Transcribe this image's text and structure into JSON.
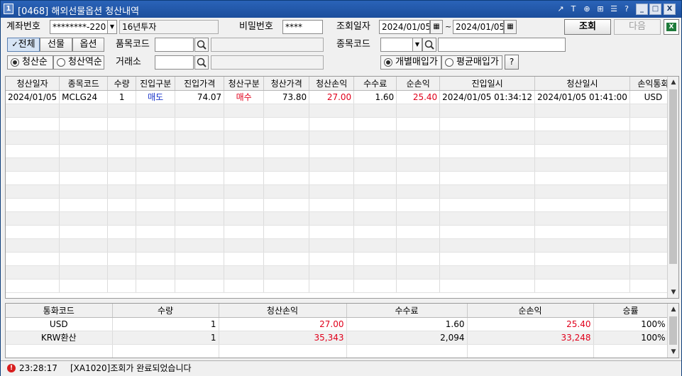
{
  "window": {
    "title": "[0468] 해외선물옵션 청산내역",
    "screen_num": "1",
    "title_buttons": [
      "↗",
      "T",
      "⊕",
      "⊞",
      "☰",
      "?"
    ],
    "win_buttons": [
      "_",
      "□",
      "X"
    ]
  },
  "form": {
    "account_label": "계좌번호",
    "account_value": "********-220",
    "account_name": "16년투자",
    "password_label": "비밀번호",
    "password_value": "****",
    "date_label": "조회일자",
    "date_from": "2024/01/05",
    "date_sep": "~",
    "date_to": "2024/01/05",
    "query_button": "조회",
    "next_button": "다음",
    "excel_icon": "excel-icon",
    "type_all": "전체",
    "type_futures": "선물",
    "type_options": "옵션",
    "product_code_label": "품목코드",
    "product_code_value": "",
    "item_code_label": "종목코드",
    "item_code_value": "",
    "order_asc": "청산순",
    "order_desc": "청산역순",
    "exchange_label": "거래소",
    "exchange_value": "",
    "purchase_individual": "개별매입가",
    "purchase_average": "평균매입가",
    "help_button": "?"
  },
  "main_table": {
    "columns": [
      "청산일자",
      "종목코드",
      "수량",
      "진입구분",
      "진입가격",
      "청산구분",
      "청산가격",
      "청산손익",
      "수수료",
      "순손익",
      "진입일시",
      "청산일시",
      "손익통화"
    ],
    "rows": [
      [
        "2024/01/05",
        "MCLG24",
        "1",
        "매도",
        "74.07",
        "매수",
        "73.80",
        "27.00",
        "1.60",
        "25.40",
        "2024/01/05 01:34:12",
        "2024/01/05 01:41:00",
        "USD"
      ]
    ]
  },
  "summary_table": {
    "columns": [
      "통화코드",
      "수량",
      "청산손익",
      "수수료",
      "순손익",
      "승률"
    ],
    "rows": [
      [
        "USD",
        "1",
        "27.00",
        "1.60",
        "25.40",
        "100%"
      ],
      [
        "KRW환산",
        "1",
        "35,343",
        "2,094",
        "33,248",
        "100%"
      ]
    ]
  },
  "status": {
    "time": "23:28:17",
    "message": "[XA1020]조회가 완료되었습니다"
  },
  "colors": {
    "profit_red": "#e0001b",
    "sell_blue": "#1a35c9",
    "title_blue": "#1c4e9c"
  }
}
